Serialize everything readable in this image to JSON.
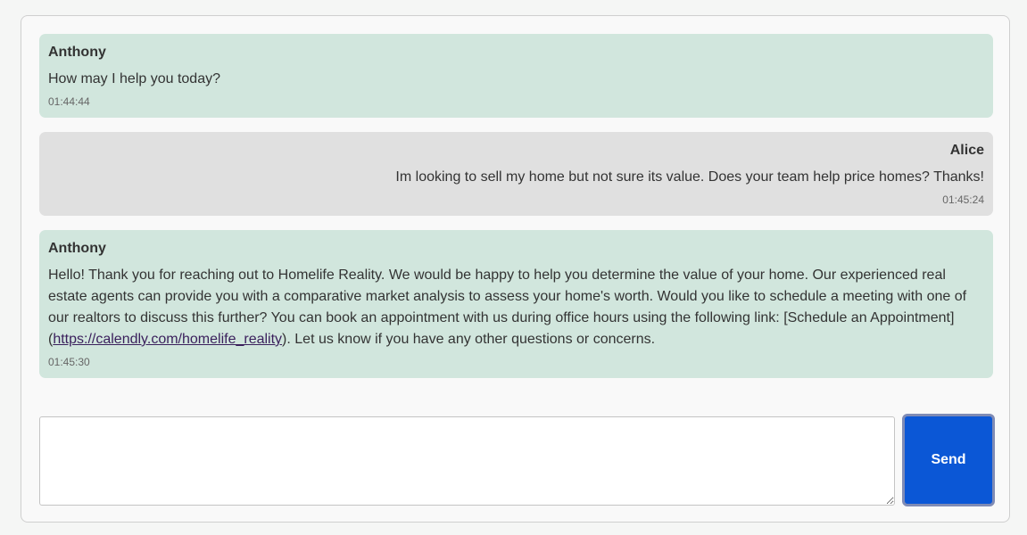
{
  "messages": [
    {
      "role": "bot",
      "sender": "Anthony",
      "text": "How may I help you today?",
      "time": "01:44:44"
    },
    {
      "role": "user",
      "sender": "Alice",
      "text": "Im looking to sell my home but not sure its value. Does your team help price homes? Thanks!",
      "time": "01:45:24"
    },
    {
      "role": "bot",
      "sender": "Anthony",
      "text_before_link": "Hello! Thank you for reaching out to Homelife Reality. We would be happy to help you determine the value of your home. Our experienced real estate agents can provide you with a comparative market analysis to assess your home's worth. Would you like to schedule a meeting with one of our realtors to discuss this further? You can book an appointment with us during office hours using the following link: [Schedule an Appointment] (",
      "link_text": "https://calendly.com/homelife_reality",
      "text_after_link": "). Let us know if you have any other questions or concerns.",
      "time": "01:45:30"
    }
  ],
  "composer": {
    "input_value": "",
    "send_label": "Send"
  },
  "colors": {
    "bot_bubble": "#d1e6dd",
    "user_bubble": "#e0e0e0",
    "send_button": "#0b57d6"
  }
}
